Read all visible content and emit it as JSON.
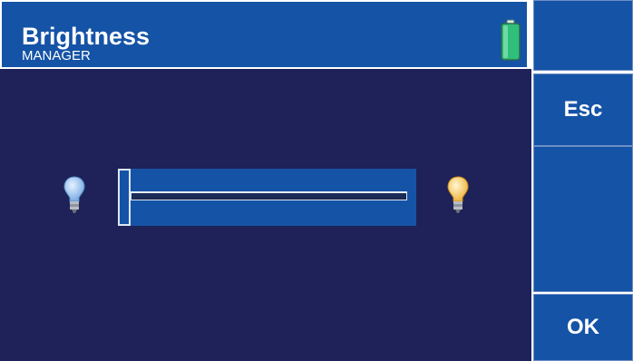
{
  "header": {
    "title": "Brightness",
    "subtitle": "MANAGER",
    "battery_icon": "battery-icon"
  },
  "side_buttons": {
    "top_label": "",
    "esc_label": "Esc",
    "middle_label": "",
    "ok_label": "OK"
  },
  "brightness": {
    "level": 0.0,
    "min_icon": "dim-bulb-icon",
    "max_icon": "bright-bulb-icon"
  },
  "colors": {
    "panel": "#1553a6",
    "background": "#1e2258",
    "battery": "#2fbf7a"
  }
}
